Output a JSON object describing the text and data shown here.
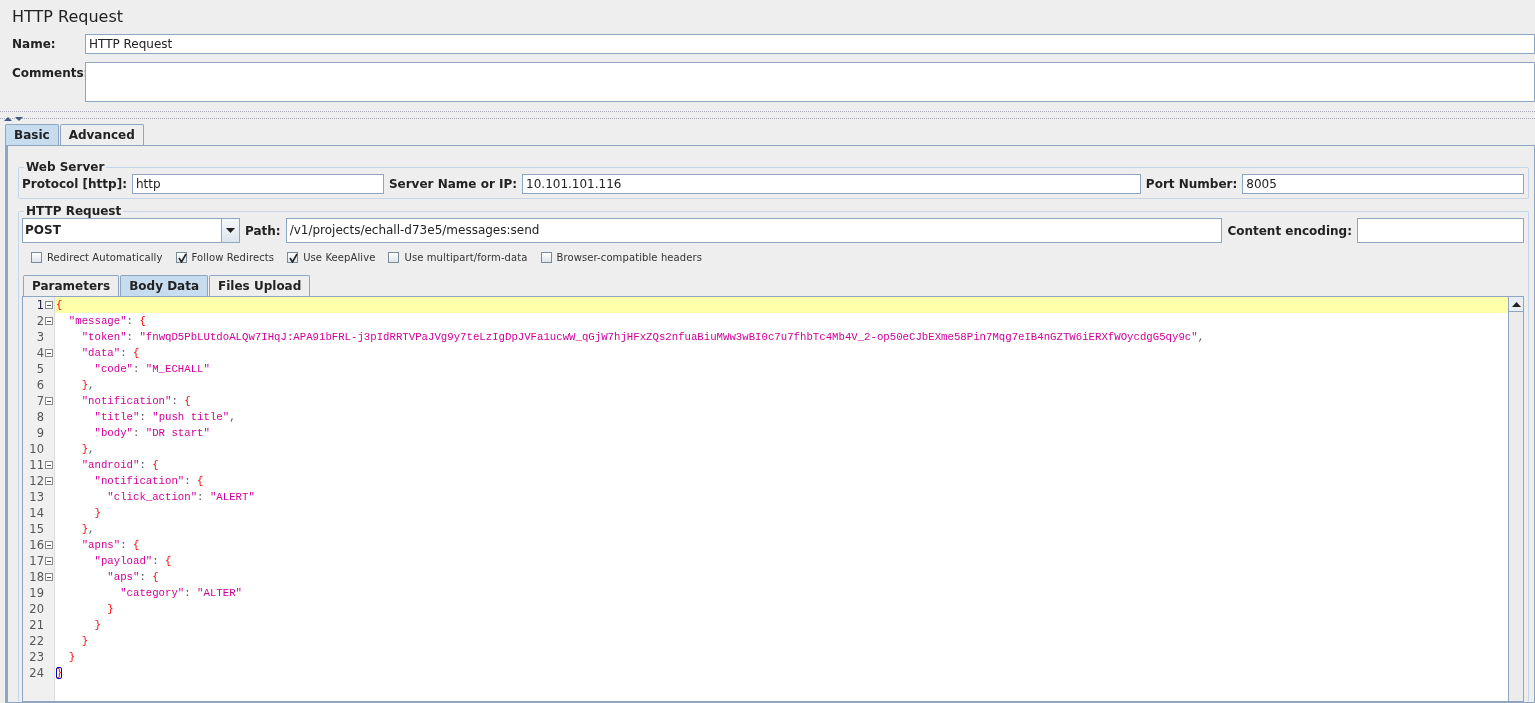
{
  "panel": {
    "title": "HTTP Request"
  },
  "name": {
    "label": "Name:",
    "value": "HTTP Request"
  },
  "comments": {
    "label": "Comments:"
  },
  "tabs": [
    {
      "label": "Basic",
      "selected": true
    },
    {
      "label": "Advanced",
      "selected": false
    }
  ],
  "web_server": {
    "title": "Web Server",
    "fields": [
      {
        "label": "Protocol [http]:",
        "value": "http"
      },
      {
        "label": "Server Name or IP:",
        "value": "10.101.101.116"
      },
      {
        "label": "Port Number:",
        "value": "8005"
      }
    ]
  },
  "http_request": {
    "title": "HTTP Request",
    "method": "POST",
    "path": {
      "label": "Path:",
      "value": "/v1/projects/echall-d73e5/messages:send"
    },
    "content_encoding": {
      "label": "Content encoding:"
    },
    "options": [
      {
        "label": "Redirect Automatically",
        "checked": false
      },
      {
        "label": "Follow Redirects",
        "checked": true
      },
      {
        "label": "Use KeepAlive",
        "checked": true
      },
      {
        "label": "Use multipart/form-data",
        "checked": false
      },
      {
        "label": "Browser-compatible headers",
        "checked": false
      }
    ],
    "tabs": [
      {
        "label": "Parameters",
        "selected": false
      },
      {
        "label": "Body Data",
        "selected": true
      },
      {
        "label": "Files Upload",
        "selected": false
      }
    ],
    "editor": {
      "lines": [
        {
          "number": "1",
          "text": "{",
          "foldable": true,
          "selected": true,
          "matched": false
        },
        {
          "number": "2",
          "text": "  \"message\": {",
          "foldable": true,
          "selected": false,
          "matched": false
        },
        {
          "number": "3",
          "text": "    \"token\": \"fnwqD5PbLUtdoALQw7IHqJ:APA91bFRL-j3pIdRRTVPaJVg9y7teLzIgDpJVFa1ucwW_qGjW7hjHFxZQs2nfuaBiuMWw3wBI0c7u7fhbTc4Mb4V_2-op50eCJbEXme58Pin7Mqg7eIB4nGZTW6iERXfWOycdgG5qy9c\",",
          "foldable": false,
          "selected": false,
          "matched": false
        },
        {
          "number": "4",
          "text": "    \"data\": {",
          "foldable": true,
          "selected": false,
          "matched": false
        },
        {
          "number": "5",
          "text": "      \"code\": \"M_ECHALL\"",
          "foldable": false,
          "selected": false,
          "matched": false
        },
        {
          "number": "6",
          "text": "    },",
          "foldable": false,
          "selected": false,
          "matched": false
        },
        {
          "number": "7",
          "text": "    \"notification\": {",
          "foldable": true,
          "selected": false,
          "matched": false
        },
        {
          "number": "8",
          "text": "      \"title\": \"push title\",",
          "foldable": false,
          "selected": false,
          "matched": false
        },
        {
          "number": "9",
          "text": "      \"body\": \"DR start\"",
          "foldable": false,
          "selected": false,
          "matched": false
        },
        {
          "number": "10",
          "text": "    },",
          "foldable": false,
          "selected": false,
          "matched": false
        },
        {
          "number": "11",
          "text": "    \"android\": {",
          "foldable": true,
          "selected": false,
          "matched": false
        },
        {
          "number": "12",
          "text": "      \"notification\": {",
          "foldable": true,
          "selected": false,
          "matched": false
        },
        {
          "number": "13",
          "text": "        \"click_action\": \"ALERT\"",
          "foldable": false,
          "selected": false,
          "matched": false
        },
        {
          "number": "14",
          "text": "      }",
          "foldable": false,
          "selected": false,
          "matched": false
        },
        {
          "number": "15",
          "text": "    },",
          "foldable": false,
          "selected": false,
          "matched": false
        },
        {
          "number": "16",
          "text": "    \"apns\": {",
          "foldable": true,
          "selected": false,
          "matched": false
        },
        {
          "number": "17",
          "text": "      \"payload\": {",
          "foldable": true,
          "selected": false,
          "matched": false
        },
        {
          "number": "18",
          "text": "        \"aps\": {",
          "foldable": true,
          "selected": false,
          "matched": false
        },
        {
          "number": "19",
          "text": "          \"category\": \"ALTER\"",
          "foldable": false,
          "selected": false,
          "matched": false
        },
        {
          "number": "20",
          "text": "        }",
          "foldable": false,
          "selected": false,
          "matched": false
        },
        {
          "number": "21",
          "text": "      }",
          "foldable": false,
          "selected": false,
          "matched": false
        },
        {
          "number": "22",
          "text": "    }",
          "foldable": false,
          "selected": false,
          "matched": false
        },
        {
          "number": "23",
          "text": "  }",
          "foldable": false,
          "selected": false,
          "matched": false
        },
        {
          "number": "24",
          "text": "}",
          "foldable": false,
          "selected": false,
          "matched": true
        }
      ]
    }
  }
}
